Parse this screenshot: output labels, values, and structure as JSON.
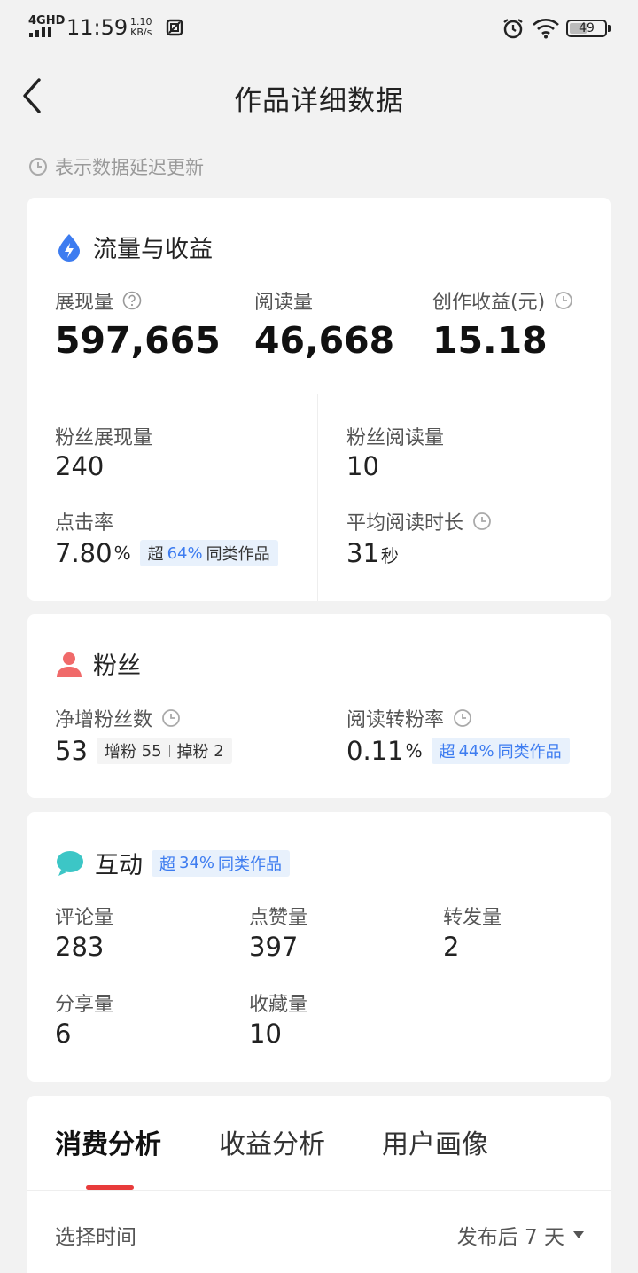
{
  "status_bar": {
    "network": "4GHD",
    "time": "11:59",
    "speed_value": "1.10",
    "speed_unit": "KB/s",
    "battery": "49"
  },
  "nav": {
    "title": "作品详细数据"
  },
  "notice": "表示数据延迟更新",
  "traffic": {
    "title": "流量与收益",
    "impressions_label": "展现量",
    "impressions": "597,665",
    "reads_label": "阅读量",
    "reads": "46,668",
    "earnings_label": "创作收益(元)",
    "earnings": "15.18",
    "fan_impressions_label": "粉丝展现量",
    "fan_impressions": "240",
    "fan_reads_label": "粉丝阅读量",
    "fan_reads": "10",
    "ctr_label": "点击率",
    "ctr": "7.80",
    "ctr_unit": "%",
    "ctr_tag_prefix": "超",
    "ctr_tag_value": "64%",
    "ctr_tag_suffix": "同类作品",
    "avg_time_label": "平均阅读时长",
    "avg_time": "31",
    "avg_time_unit": "秒"
  },
  "fans": {
    "title": "粉丝",
    "net_label": "净增粉丝数",
    "net": "53",
    "gain_label": "增粉",
    "gain": "55",
    "loss_label": "掉粉",
    "loss": "2",
    "conv_label": "阅读转粉率",
    "conv": "0.11",
    "conv_unit": "%",
    "conv_tag_prefix": "超",
    "conv_tag_value": "44%",
    "conv_tag_suffix": "同类作品"
  },
  "interaction": {
    "title": "互动",
    "tag_prefix": "超",
    "tag_value": "34%",
    "tag_suffix": "同类作品",
    "comments_label": "评论量",
    "comments": "283",
    "likes_label": "点赞量",
    "likes": "397",
    "reposts_label": "转发量",
    "reposts": "2",
    "shares_label": "分享量",
    "shares": "6",
    "favorites_label": "收藏量",
    "favorites": "10"
  },
  "tabs": {
    "items": [
      "消费分析",
      "收益分析",
      "用户画像"
    ],
    "time_label": "选择时间",
    "time_value": "发布后 7 天"
  },
  "colors": {
    "accent_blue": "#3d7cf0",
    "tab_indicator": "#e83b3b",
    "fans_icon": "#f06a6a",
    "interaction_icon": "#3cc6c6"
  }
}
